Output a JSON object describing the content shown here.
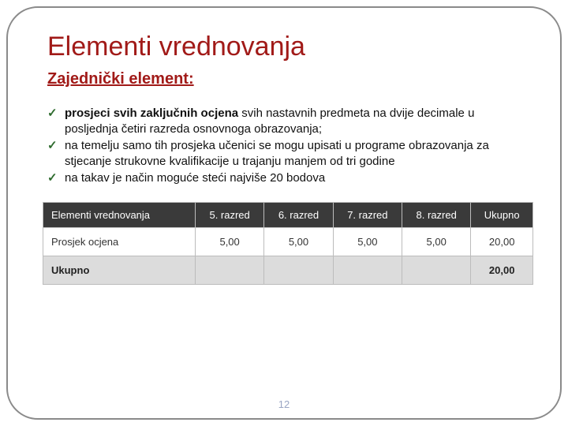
{
  "title": "Elementi vrednovanja",
  "subtitle": "Zajednički element:",
  "bullets": [
    {
      "bold": "prosjeci svih zaključnih ocjena",
      "rest": " svih nastavnih predmeta na dvije decimale u posljednja četiri razreda osnovnoga obrazovanja;"
    },
    {
      "bold": "",
      "rest": "na temelju samo tih prosjeka učenici se mogu upisati u programe obrazovanja za stjecanje strukovne kvalifikacije u trajanju manjem od tri godine"
    },
    {
      "bold": "",
      "rest": "na takav je način moguće steći najviše 20 bodova"
    }
  ],
  "table": {
    "headers": [
      "Elementi vrednovanja",
      "5. razred",
      "6. razred",
      "7. razred",
      "8. razred",
      "Ukupno"
    ],
    "rows": [
      [
        "Prosjek ocjena",
        "5,00",
        "5,00",
        "5,00",
        "5,00",
        "20,00"
      ],
      [
        "Ukupno",
        "",
        "",
        "",
        "",
        "20,00"
      ]
    ]
  },
  "page_number": "12",
  "checkmark": "✓"
}
